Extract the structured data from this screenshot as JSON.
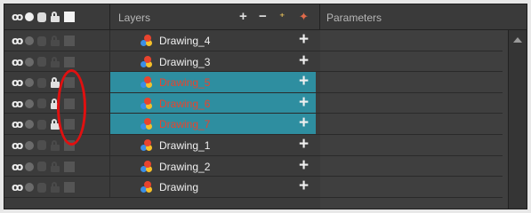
{
  "header": {
    "layers_label": "Layers",
    "parameters_label": "Parameters",
    "tools": {
      "add": "+",
      "remove": "−",
      "add_sub": "⁺",
      "effect": "✦"
    }
  },
  "colors": {
    "selection": "#2e8ea0",
    "selected_text": "#e8442e",
    "annotation": "#e01010"
  },
  "layers": [
    {
      "name": "Drawing_4",
      "selected": false,
      "locked": false
    },
    {
      "name": "Drawing_3",
      "selected": false,
      "locked": false
    },
    {
      "name": "Drawing_5",
      "selected": true,
      "locked": true
    },
    {
      "name": "Drawing_6",
      "selected": true,
      "locked": true
    },
    {
      "name": "Drawing_7",
      "selected": true,
      "locked": true
    },
    {
      "name": "Drawing_1",
      "selected": false,
      "locked": false
    },
    {
      "name": "Drawing_2",
      "selected": false,
      "locked": false
    },
    {
      "name": "Drawing",
      "selected": false,
      "locked": false
    }
  ],
  "row_add_glyph": "+"
}
